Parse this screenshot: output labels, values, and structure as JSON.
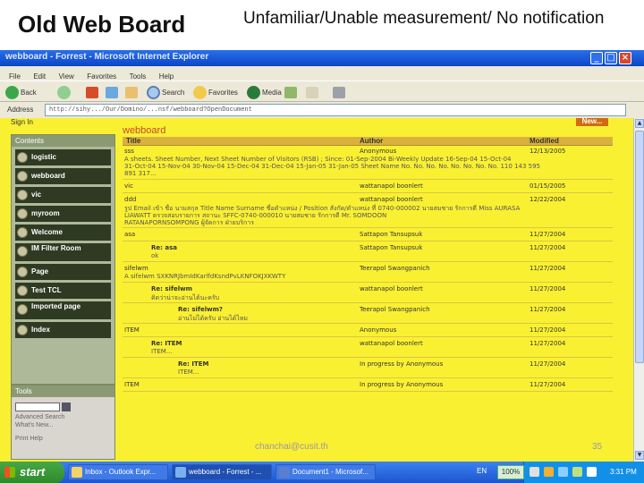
{
  "slide": {
    "title": "Old Web Board",
    "subtitle": "Unfamiliar/Unable measurement/ No notification",
    "watermark": "chanchai@cusit.th",
    "page_number": "35"
  },
  "browser": {
    "window_title": "webboard - Forrest - Microsoft Internet Explorer",
    "menu": [
      "File",
      "Edit",
      "View",
      "Favorites",
      "Tools",
      "Help"
    ],
    "toolbar": {
      "back": "Back",
      "search": "Search",
      "favorites": "Favorites",
      "media": "Media"
    },
    "address_label": "Address",
    "address_value": "http://sihy.../Our/Domino/...nsf/webboard?OpenDocument",
    "sign_in": "Sign In",
    "new_button": "New...",
    "icons": [
      "back-icon",
      "forward-icon",
      "stop-icon",
      "refresh-icon",
      "home-icon",
      "search-icon",
      "favorites-icon",
      "media-icon",
      "history-icon",
      "mail-icon",
      "print-icon"
    ]
  },
  "sidebar": {
    "header": "Contents",
    "items": [
      {
        "label": "logistic"
      },
      {
        "label": "webboard"
      },
      {
        "label": "vic"
      },
      {
        "label": "myroom"
      },
      {
        "label": "Welcome"
      },
      {
        "label": "IM Filter Room"
      },
      {
        "label": "Page"
      },
      {
        "label": "Test TCL"
      },
      {
        "label": "Imported page"
      },
      {
        "label": "Index"
      }
    ],
    "tools_header": "Tools",
    "tools_links": [
      "Advanced Search",
      "What's New...",
      "Print  Help"
    ]
  },
  "board": {
    "title": "webboard",
    "columns": [
      "Title",
      "Author",
      "Modified"
    ],
    "rows": [
      {
        "title": "sss",
        "author": "Anonymous",
        "date": "12/13/2005",
        "body": [
          "A sheets. Sheet Number, Next Sheet Number of Visitors (RSB) ; Since: 01-Sep-2004 Bi-Weekly Update 16-Sep-04 15-Oct-04",
          "31-Oct-04 15-Nov-04 30-Nov-04 15-Dec-04 31-Dec-04 15-Jan-05 31-Jan-05 Sheet Name No. No. No. No. No. No. No. No. 110 143 595",
          "891 317..."
        ]
      },
      {
        "title": "vic",
        "author": "wattanapol boonlert",
        "date": "01/15/2005",
        "body": []
      },
      {
        "title": "ddd",
        "author": "wattanapol boonlert",
        "date": "12/22/2004",
        "body": [
          "รูป Email เข้า ชื่อ นามสกุล Title Name Surname ชื่อตำแหน่ง / Position สังกัด/ตำแหน่ง ที่ 0740-000002 นายสมชาย รักการดี Miss AURASA",
          "LIAWATT ตรวจสอบรายการ สถานะ SFFC-0740-000010 นายสมชาย รักการดี Mr. SOMDOON",
          "RATANAPORNSOMPONG ผู้จัดการ ฝ่ายบริการ"
        ]
      },
      {
        "title": "asa",
        "author": "Sattapon Tansupsuk",
        "date": "11/27/2004",
        "body": []
      },
      {
        "title": "Re: asa",
        "author": "Sattapon Tansupsuk",
        "date": "11/27/2004",
        "body": [
          "ok"
        ],
        "indent": 1
      },
      {
        "title": "sifelwm",
        "author": "Teerapol Swangpanich",
        "date": "11/27/2004",
        "body": [
          "A sifelwm SXKNRJbmIdKarlfdKsndPvLKNFOKJXKWTY"
        ]
      },
      {
        "title": "Re: sifelwm",
        "author": "wattanapol boonlert",
        "date": "11/27/2004",
        "body": [
          "คิดว่าน่าจะอ่านได้นะครับ"
        ],
        "indent": 1
      },
      {
        "title": "Re: sifelwm?",
        "author": "Teerapol Swangpanich",
        "date": "11/27/2004",
        "body": [
          "อ่านไม่ได้ครับ อ่านได้ไหม"
        ],
        "indent": 2
      },
      {
        "title": "ITEM",
        "author": "Anonymous",
        "date": "11/27/2004",
        "body": []
      },
      {
        "title": "Re: ITEM",
        "author": "wattanapol boonlert",
        "date": "11/27/2004",
        "body": [
          "ITEM..."
        ],
        "indent": 1
      },
      {
        "title": "Re: ITEM",
        "author": "In progress by Anonymous",
        "date": "11/27/2004",
        "body": [
          "ITEM..."
        ],
        "indent": 2
      },
      {
        "title": "ITEM",
        "author": "In progress by Anonymous",
        "date": "11/27/2004",
        "body": []
      }
    ]
  },
  "taskbar": {
    "start_label": "start",
    "tasks": [
      "Inbox - Outlook Expr...",
      "webboard - Forrest - ...",
      "Document1 - Microsof..."
    ],
    "language": "EN",
    "zoom": "100%",
    "clock": "3:31 PM"
  }
}
